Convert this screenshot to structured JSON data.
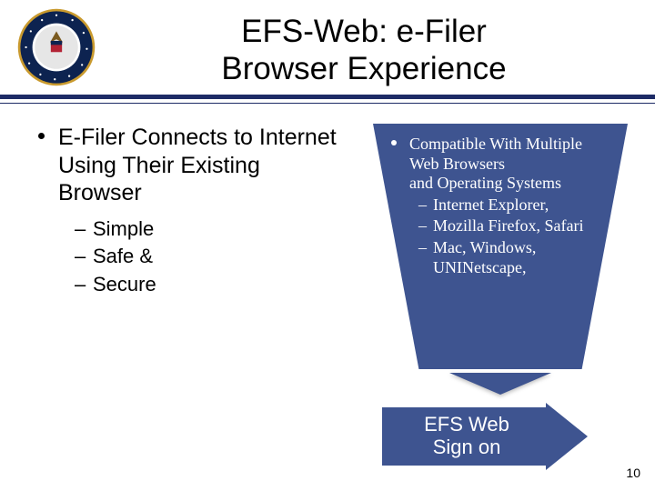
{
  "title": {
    "line1": "EFS-Web: e-Filer",
    "line2": "Browser Experience"
  },
  "left": {
    "main_bullet": "E-Filer Connects to Internet Using Their Existing Browser",
    "sub_bullets": [
      "Simple",
      "Safe &",
      "Secure"
    ]
  },
  "right_callout": {
    "lead_lines": [
      "Compatible With Multiple",
      "Web Browsers",
      "and Operating Systems"
    ],
    "items": [
      "Internet Explorer,",
      "Mozilla Firefox, Safari",
      "Mac, Windows, UNINetscape,"
    ]
  },
  "signon": {
    "label": "EFS Web Sign on"
  },
  "colors": {
    "accent": "#3e5490",
    "rule": "#1d2b66"
  },
  "page_number": "10",
  "seal": {
    "name": "uspto-seal-icon",
    "outer_ring_color": "#0d2350",
    "inner_fill": "#ffffff",
    "gold": "#c99a2e"
  }
}
